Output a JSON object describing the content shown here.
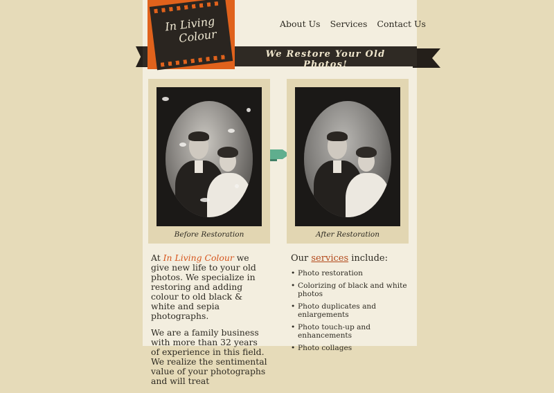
{
  "logo": {
    "line1": "In Living",
    "line2": "Colour"
  },
  "tagline": "We Restore Your Old Photos!",
  "nav": [
    "About Us",
    "Services",
    "Contact Us"
  ],
  "photos": {
    "before_caption": "Before Restoration",
    "after_caption": "After Restoration"
  },
  "intro": {
    "p1_prefix": "At ",
    "brand": "In Living Colour",
    "p1_suffix": " we give new life to your old photos. We specialize in restoring and adding colour to old black & white and sepia photographs.",
    "p2": "We are a family business with more than 32 years of experience in this field. We realize the sentimental value of your photographs and will treat"
  },
  "services": {
    "heading_prefix": "Our ",
    "heading_link": "services",
    "heading_suffix": " include:",
    "items": [
      "Photo restoration",
      "Colorizing of black and white photos",
      "Photo duplicates and enlargements",
      "Photo touch-up and enhancements",
      "Photo collages"
    ]
  },
  "colors": {
    "accent": "#e0621c",
    "ribbon": "#2f2a24",
    "arrow": "#5fae8e",
    "link": "#b34a1c"
  },
  "icons": {
    "arrow": "right-arrow-icon"
  }
}
